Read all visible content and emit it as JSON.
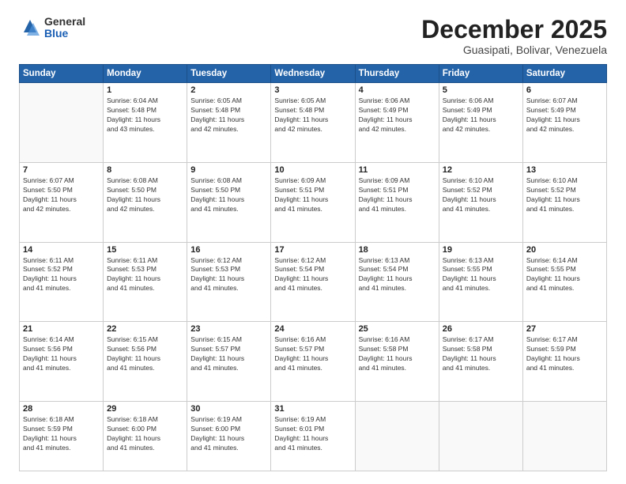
{
  "logo": {
    "general": "General",
    "blue": "Blue"
  },
  "header": {
    "month": "December 2025",
    "location": "Guasipati, Bolivar, Venezuela"
  },
  "weekdays": [
    "Sunday",
    "Monday",
    "Tuesday",
    "Wednesday",
    "Thursday",
    "Friday",
    "Saturday"
  ],
  "weeks": [
    [
      {
        "day": "",
        "info": ""
      },
      {
        "day": "1",
        "info": "Sunrise: 6:04 AM\nSunset: 5:48 PM\nDaylight: 11 hours\nand 43 minutes."
      },
      {
        "day": "2",
        "info": "Sunrise: 6:05 AM\nSunset: 5:48 PM\nDaylight: 11 hours\nand 42 minutes."
      },
      {
        "day": "3",
        "info": "Sunrise: 6:05 AM\nSunset: 5:48 PM\nDaylight: 11 hours\nand 42 minutes."
      },
      {
        "day": "4",
        "info": "Sunrise: 6:06 AM\nSunset: 5:49 PM\nDaylight: 11 hours\nand 42 minutes."
      },
      {
        "day": "5",
        "info": "Sunrise: 6:06 AM\nSunset: 5:49 PM\nDaylight: 11 hours\nand 42 minutes."
      },
      {
        "day": "6",
        "info": "Sunrise: 6:07 AM\nSunset: 5:49 PM\nDaylight: 11 hours\nand 42 minutes."
      }
    ],
    [
      {
        "day": "7",
        "info": "Sunrise: 6:07 AM\nSunset: 5:50 PM\nDaylight: 11 hours\nand 42 minutes."
      },
      {
        "day": "8",
        "info": "Sunrise: 6:08 AM\nSunset: 5:50 PM\nDaylight: 11 hours\nand 42 minutes."
      },
      {
        "day": "9",
        "info": "Sunrise: 6:08 AM\nSunset: 5:50 PM\nDaylight: 11 hours\nand 41 minutes."
      },
      {
        "day": "10",
        "info": "Sunrise: 6:09 AM\nSunset: 5:51 PM\nDaylight: 11 hours\nand 41 minutes."
      },
      {
        "day": "11",
        "info": "Sunrise: 6:09 AM\nSunset: 5:51 PM\nDaylight: 11 hours\nand 41 minutes."
      },
      {
        "day": "12",
        "info": "Sunrise: 6:10 AM\nSunset: 5:52 PM\nDaylight: 11 hours\nand 41 minutes."
      },
      {
        "day": "13",
        "info": "Sunrise: 6:10 AM\nSunset: 5:52 PM\nDaylight: 11 hours\nand 41 minutes."
      }
    ],
    [
      {
        "day": "14",
        "info": "Sunrise: 6:11 AM\nSunset: 5:52 PM\nDaylight: 11 hours\nand 41 minutes."
      },
      {
        "day": "15",
        "info": "Sunrise: 6:11 AM\nSunset: 5:53 PM\nDaylight: 11 hours\nand 41 minutes."
      },
      {
        "day": "16",
        "info": "Sunrise: 6:12 AM\nSunset: 5:53 PM\nDaylight: 11 hours\nand 41 minutes."
      },
      {
        "day": "17",
        "info": "Sunrise: 6:12 AM\nSunset: 5:54 PM\nDaylight: 11 hours\nand 41 minutes."
      },
      {
        "day": "18",
        "info": "Sunrise: 6:13 AM\nSunset: 5:54 PM\nDaylight: 11 hours\nand 41 minutes."
      },
      {
        "day": "19",
        "info": "Sunrise: 6:13 AM\nSunset: 5:55 PM\nDaylight: 11 hours\nand 41 minutes."
      },
      {
        "day": "20",
        "info": "Sunrise: 6:14 AM\nSunset: 5:55 PM\nDaylight: 11 hours\nand 41 minutes."
      }
    ],
    [
      {
        "day": "21",
        "info": "Sunrise: 6:14 AM\nSunset: 5:56 PM\nDaylight: 11 hours\nand 41 minutes."
      },
      {
        "day": "22",
        "info": "Sunrise: 6:15 AM\nSunset: 5:56 PM\nDaylight: 11 hours\nand 41 minutes."
      },
      {
        "day": "23",
        "info": "Sunrise: 6:15 AM\nSunset: 5:57 PM\nDaylight: 11 hours\nand 41 minutes."
      },
      {
        "day": "24",
        "info": "Sunrise: 6:16 AM\nSunset: 5:57 PM\nDaylight: 11 hours\nand 41 minutes."
      },
      {
        "day": "25",
        "info": "Sunrise: 6:16 AM\nSunset: 5:58 PM\nDaylight: 11 hours\nand 41 minutes."
      },
      {
        "day": "26",
        "info": "Sunrise: 6:17 AM\nSunset: 5:58 PM\nDaylight: 11 hours\nand 41 minutes."
      },
      {
        "day": "27",
        "info": "Sunrise: 6:17 AM\nSunset: 5:59 PM\nDaylight: 11 hours\nand 41 minutes."
      }
    ],
    [
      {
        "day": "28",
        "info": "Sunrise: 6:18 AM\nSunset: 5:59 PM\nDaylight: 11 hours\nand 41 minutes."
      },
      {
        "day": "29",
        "info": "Sunrise: 6:18 AM\nSunset: 6:00 PM\nDaylight: 11 hours\nand 41 minutes."
      },
      {
        "day": "30",
        "info": "Sunrise: 6:19 AM\nSunset: 6:00 PM\nDaylight: 11 hours\nand 41 minutes."
      },
      {
        "day": "31",
        "info": "Sunrise: 6:19 AM\nSunset: 6:01 PM\nDaylight: 11 hours\nand 41 minutes."
      },
      {
        "day": "",
        "info": ""
      },
      {
        "day": "",
        "info": ""
      },
      {
        "day": "",
        "info": ""
      }
    ]
  ]
}
